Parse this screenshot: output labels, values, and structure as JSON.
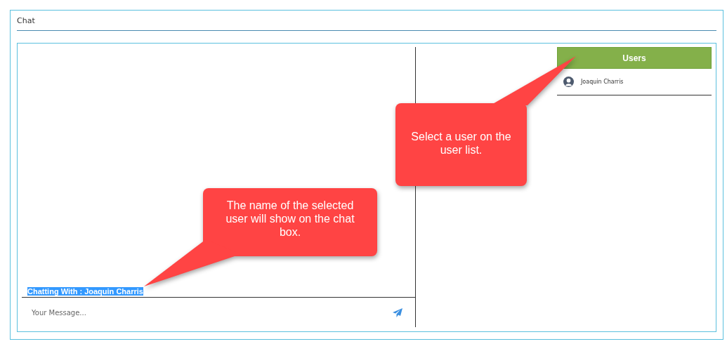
{
  "panel": {
    "title": "Chat"
  },
  "chat": {
    "chatting_with": "Chatting With : Joaquin Charris",
    "message_placeholder": "Your Message..."
  },
  "users": {
    "header": "Users",
    "items": [
      {
        "name": "Joaquin Charris"
      }
    ]
  },
  "callouts": [
    {
      "text": "Select a user on the user list."
    },
    {
      "text": "The name of the selected user will show on the chat box."
    }
  ]
}
